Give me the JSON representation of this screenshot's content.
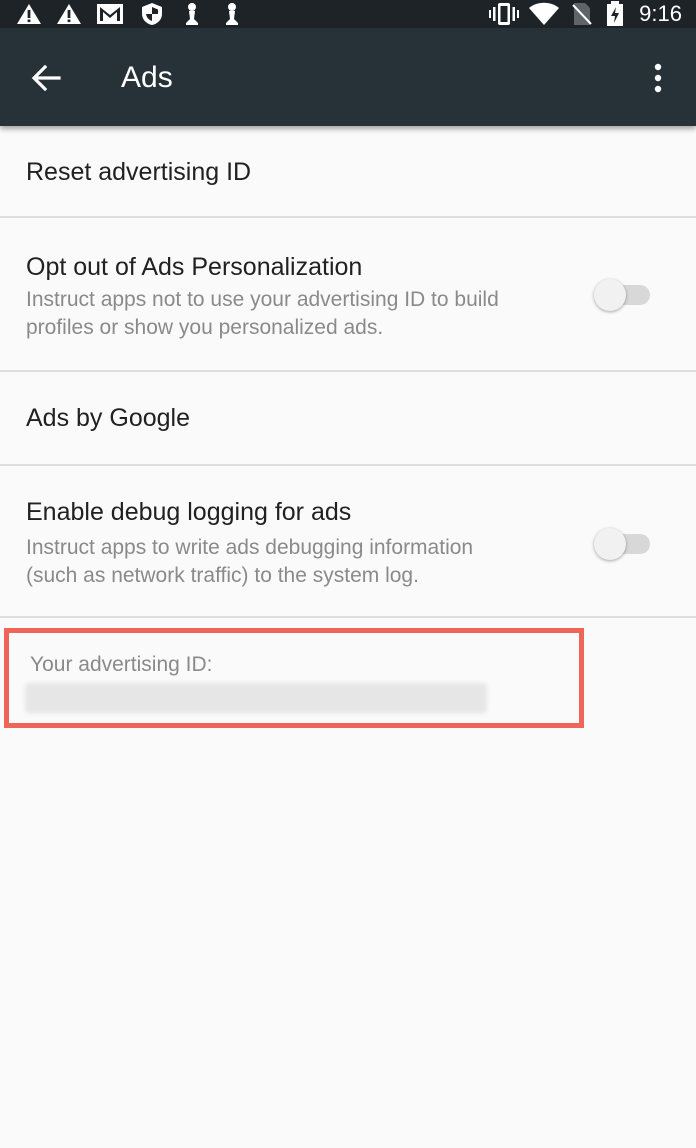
{
  "status_bar": {
    "time": "9:16",
    "left_icons": [
      "warning-icon",
      "warning-icon",
      "gmail-icon",
      "shield-icon",
      "chess-pawn-icon",
      "chess-pawn-icon"
    ],
    "right_icons": [
      "vibrate-icon",
      "wifi-icon",
      "no-sim-icon",
      "battery-icon"
    ]
  },
  "app_bar": {
    "title": "Ads",
    "background": "#263238"
  },
  "settings": {
    "reset_id": {
      "title": "Reset advertising ID"
    },
    "opt_out": {
      "title": "Opt out of Ads Personalization",
      "summary_line1": "Instruct apps not to use your advertising ID to build",
      "summary_line2": "profiles or show you personalized ads.",
      "enabled": false
    },
    "ads_by_google": {
      "title": "Ads by Google"
    },
    "debug_logging": {
      "title": "Enable debug logging for ads",
      "summary_line1": "Instruct apps to write ads debugging information",
      "summary_line2": "(such as network traffic) to the system log.",
      "enabled": false
    }
  },
  "advertising_id": {
    "label": "Your advertising ID:",
    "highlight_color": "#ee6659"
  }
}
